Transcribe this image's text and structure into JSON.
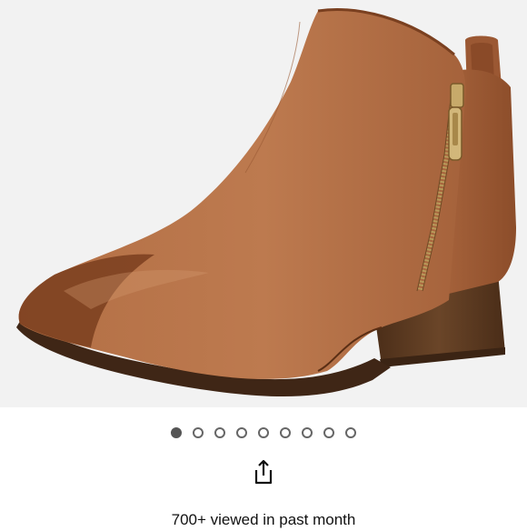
{
  "product": {
    "image_alt": "Brown leather ankle bootie with side zipper",
    "image_icon": "ankle-boot-image",
    "colors": {
      "leather": "#a9623a",
      "leather_light": "#c07d52",
      "leather_dark": "#6e3a1e",
      "heel": "#5a3a22",
      "zipper": "#b89a5a"
    }
  },
  "carousel": {
    "total": 9,
    "active_index": 0
  },
  "share": {
    "icon": "share-icon"
  },
  "stats": {
    "viewed_text": "700+ viewed in past month"
  }
}
